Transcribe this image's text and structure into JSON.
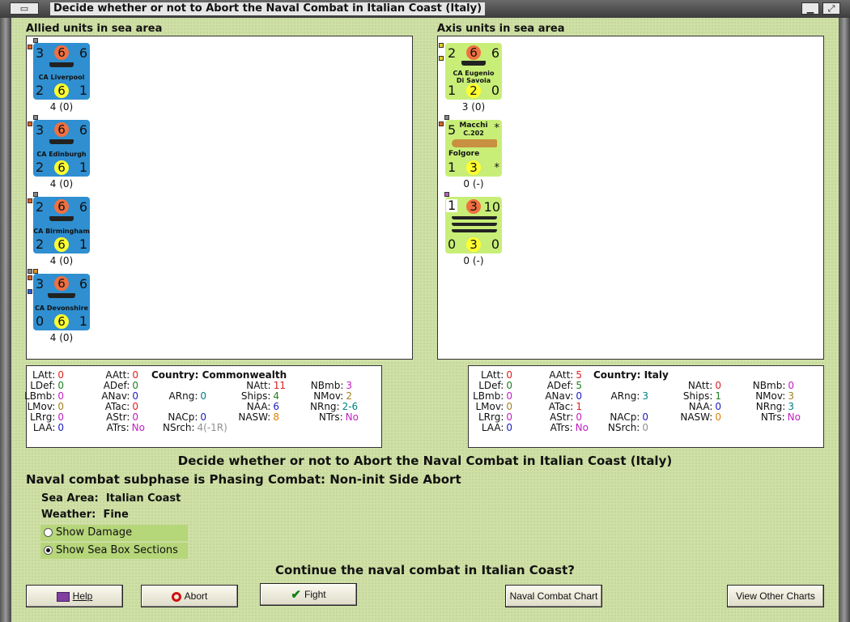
{
  "window": {
    "title": "Decide whether or not to Abort the Naval Combat in Italian Coast (Italy)"
  },
  "allied": {
    "label": "Allied units in sea area",
    "units": [
      {
        "name": "CA Liverpool",
        "tl": "3",
        "tc": "6",
        "tr": "6",
        "bl": "2",
        "bc": "6",
        "br": "1",
        "below": "4 (0)"
      },
      {
        "name": "CA Edinburgh",
        "tl": "3",
        "tc": "6",
        "tr": "6",
        "bl": "2",
        "bc": "6",
        "br": "1",
        "below": "4 (0)"
      },
      {
        "name": "CA Birmingham",
        "tl": "2",
        "tc": "6",
        "tr": "6",
        "bl": "2",
        "bc": "6",
        "br": "1",
        "below": "4 (0)"
      },
      {
        "name": "CA Devonshire",
        "tl": "3",
        "tc": "6",
        "tr": "6",
        "bl": "0",
        "bc": "6",
        "br": "1",
        "below": "4 (0)"
      }
    ],
    "stats": {
      "country_label": "Country:",
      "country": "Commonwealth",
      "LAtt": "0",
      "LDef": "0",
      "LBmb": "0",
      "LMov": "0",
      "LRrg": "0",
      "LAA": "0",
      "AAtt": "0",
      "ADef": "0",
      "ANav": "0",
      "ATac": "0",
      "AStr": "0",
      "ATrs": "No",
      "ARng": "0",
      "NACp": "0",
      "NSrch": "4(-1R)",
      "NAtt": "11",
      "Ships": "4",
      "NAA": "6",
      "NASW": "8",
      "NBmb": "3",
      "NMov": "2",
      "NRng": "2-6",
      "NTrs": "No"
    }
  },
  "axis": {
    "label": "Axis units in sea area",
    "units": [
      {
        "name1": "CA Eugenio",
        "name2": "Di Savoia",
        "tl": "2",
        "tc": "6",
        "tr": "6",
        "bl": "1",
        "bc": "2",
        "br": "0",
        "below": "3 (0)"
      },
      {
        "name1": "Macchi",
        "name2": "C.202",
        "name3": "Folgore",
        "tl": "5",
        "tr": "*",
        "bl": "1",
        "bc": "3",
        "br": "*",
        "below": "0 (-)"
      },
      {
        "tl": "1",
        "tc": "3",
        "tr": "10",
        "bl": "0",
        "bc": "3",
        "br": "0",
        "below": "0 (-)"
      }
    ],
    "stats": {
      "country_label": "Country:",
      "country": "Italy",
      "LAtt": "0",
      "LDef": "0",
      "LBmb": "0",
      "LMov": "0",
      "LRrg": "0",
      "LAA": "0",
      "AAtt": "5",
      "ADef": "5",
      "ANav": "0",
      "ATac": "1",
      "AStr": "0",
      "ATrs": "No",
      "ARng": "3",
      "NACp": "0",
      "NSrch": "0",
      "NAtt": "0",
      "Ships": "1",
      "NAA": "0",
      "NASW": "0",
      "NBmb": "0",
      "NMov": "3",
      "NRng": "3",
      "NTrs": "No"
    }
  },
  "main": {
    "heading": "Decide whether or not to Abort the Naval Combat in Italian Coast (Italy)",
    "subphase": "Naval combat subphase is Phasing Combat: Non-init Side Abort",
    "sea_area_label": "Sea Area:",
    "sea_area": "Italian Coast",
    "weather_label": "Weather:",
    "weather": "Fine",
    "show_damage": "Show Damage",
    "show_sea_box": "Show Sea Box Sections",
    "question": "Continue the naval combat in Italian Coast?"
  },
  "buttons": {
    "help": "Help",
    "abort": "Abort",
    "fight": "Fight",
    "naval_chart": "Naval Combat Chart",
    "other_charts": "View Other Charts"
  },
  "colors": {
    "allied_counter": "#2f8fd0",
    "axis_counter": "#c8ee78",
    "background": "#cfe0a6"
  },
  "icons": [
    "restore-icon",
    "minimize-icon",
    "maximize-icon",
    "help-book-icon",
    "abort-no-icon",
    "fight-check-icon"
  ]
}
